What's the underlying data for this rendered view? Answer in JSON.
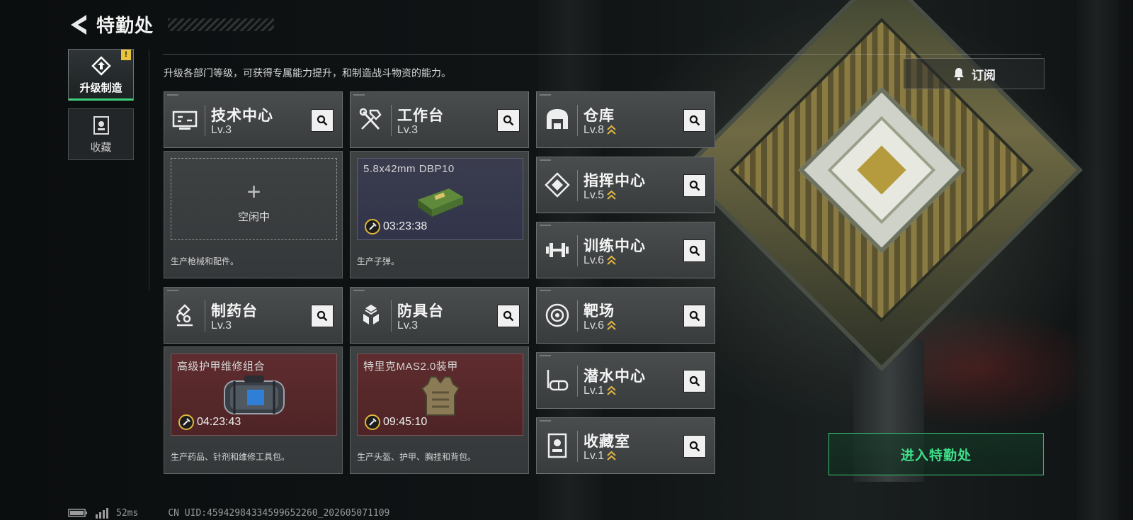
{
  "header": {
    "title": "特勤处"
  },
  "nav": [
    {
      "label": "升级制造",
      "active": true,
      "alert": "!"
    },
    {
      "label": "收藏",
      "active": false
    }
  ],
  "description": "升级各部门等级，可获得专属能力提升，和制造战斗物资的能力。",
  "subscribe": {
    "label": "订阅"
  },
  "facilities": [
    {
      "name": "技术中心",
      "level": "Lv.3",
      "icon": "tech-center-icon"
    },
    {
      "name": "工作台",
      "level": "Lv.3",
      "icon": "workbench-icon"
    },
    {
      "name": "仓库",
      "level": "Lv.8",
      "icon": "warehouse-icon",
      "upgradable": true
    },
    {
      "name": "指挥中心",
      "level": "Lv.5",
      "icon": "command-center-icon",
      "upgradable": true
    },
    {
      "name": "训练中心",
      "level": "Lv.6",
      "icon": "training-center-icon",
      "upgradable": true
    },
    {
      "name": "制药台",
      "level": "Lv.3",
      "icon": "pharmacy-icon"
    },
    {
      "name": "防具台",
      "level": "Lv.3",
      "icon": "armor-bench-icon"
    },
    {
      "name": "靶场",
      "level": "Lv.6",
      "icon": "shooting-range-icon",
      "upgradable": true
    },
    {
      "name": "潜水中心",
      "level": "Lv.1",
      "icon": "diving-center-icon",
      "upgradable": true
    },
    {
      "name": "收藏室",
      "level": "Lv.1",
      "icon": "collection-room-icon",
      "upgradable": true
    }
  ],
  "production": {
    "tech_center": {
      "plus": "+",
      "status": "空闲中",
      "desc": "生产枪械和配件。"
    },
    "workbench": {
      "item": "5.8x42mm DBP10",
      "timer": "03:23:38",
      "desc": "生产子弹。"
    },
    "pharmacy": {
      "item": "高级护甲维修组合",
      "timer": "04:23:43",
      "desc": "生产药品、针剂和维修工具包。"
    },
    "armor_bench": {
      "item": "特里克MAS2.0装甲",
      "timer": "09:45:10",
      "desc": "生产头盔、护甲、胸挂和背包。"
    }
  },
  "enter_button": {
    "label": "进入特勤处"
  },
  "footer": {
    "ping": "52ms",
    "uid": "CN UID:45942984334599652260_202605071109"
  },
  "colors": {
    "accent": "#3fd07e",
    "alert": "#e8c43c",
    "slot_red": "#5a2a2c",
    "slot_blue": "#363849"
  }
}
